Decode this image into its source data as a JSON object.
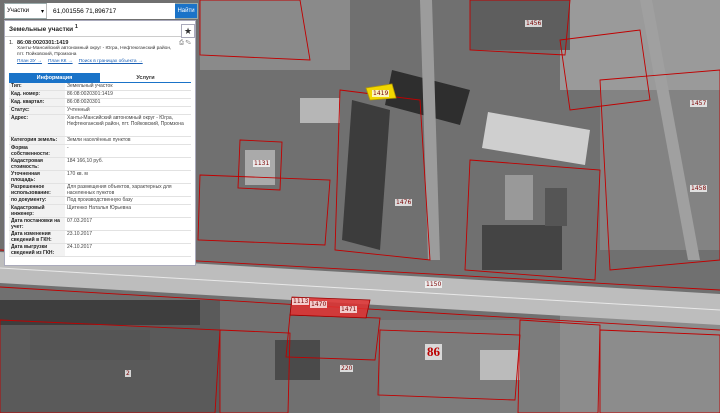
{
  "search": {
    "type_label": "Участки",
    "query": "61,001556 71,896717",
    "button_label": "Найти"
  },
  "panel": {
    "title": "Земельные участки",
    "count": "1",
    "item_number": "1.",
    "cadastral_number": "86:08:0020301:1419",
    "address": "Ханты-Мансийский автономный округ - Югра, Нефтеюганский район, пгт. Пойковский, Промзона",
    "link_3d": "План ЗУ",
    "link_ks": "План КК",
    "link_bounds": "Поиск в границах объекта",
    "tab_info": "Информация",
    "tab_services": "Услуги",
    "rows": [
      {
        "k": "Тип:",
        "v": "Земельный участок"
      },
      {
        "k": "Кад. номер:",
        "v": "86:08:0020301:1419"
      },
      {
        "k": "Кад. квартал:",
        "v": "86:08:0020301"
      },
      {
        "k": "Статус:",
        "v": "Учтенный"
      },
      {
        "k": "Адрес:",
        "v": "Ханты-Мансийский автономный округ - Югра, Нефтеюганский район, пгт. Пойковский, Промзона"
      },
      {
        "k": "Категория земель:",
        "v": "Земли населённых пунктов"
      },
      {
        "k": "Форма собственности:",
        "v": "-"
      },
      {
        "k": "Кадастровая стоимость:",
        "v": "184 166,10 руб."
      },
      {
        "k": "Уточненная площадь:",
        "v": "170 кв. м"
      },
      {
        "k": "Разрешенное использование:",
        "v": "Для размещения объектов, характерных для населенных пунктов"
      },
      {
        "k": "по документу:",
        "v": "Под производственную базу"
      },
      {
        "k": "Кадастровый инженер:",
        "v": "Щитенко Наталья Юрьевна"
      },
      {
        "k": "Дата постановки на учет:",
        "v": "07.03.2017"
      },
      {
        "k": "Дата изменения сведений в ГКН:",
        "v": "23.10.2017"
      },
      {
        "k": "Дата выгрузки сведений из ГКН:",
        "v": "24.10.2017"
      }
    ]
  },
  "map": {
    "labels": [
      "1419",
      "1113",
      "1150",
      "1131",
      "1470",
      "1471",
      "1476",
      "220",
      "1456",
      "1457",
      "1458",
      "2"
    ],
    "big_label": "86"
  },
  "colors": {
    "accent": "#1a73c8",
    "parcel": "#c00000",
    "highlight": "#f2d700"
  }
}
